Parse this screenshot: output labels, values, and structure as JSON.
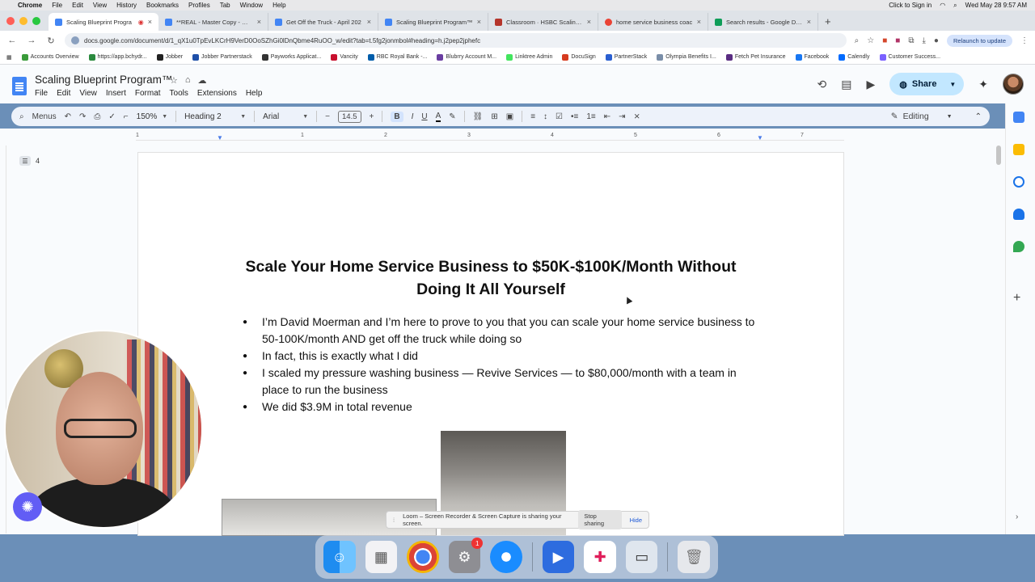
{
  "menubar": {
    "app": "Chrome",
    "items": [
      "File",
      "Edit",
      "View",
      "History",
      "Bookmarks",
      "Profiles",
      "Tab",
      "Window",
      "Help"
    ],
    "signin": "Click to Sign in",
    "datetime": "Wed May 28  9:57 AM"
  },
  "tabs": [
    {
      "label": "Scaling Blueprint Progra",
      "active": true
    },
    {
      "label": "**REAL - Master Copy - May",
      "active": false
    },
    {
      "label": "Get Off the Truck - April 202",
      "active": false
    },
    {
      "label": "Scaling Blueprint Program™",
      "active": false
    },
    {
      "label": "Classroom · HSBC Scaling B",
      "active": false
    },
    {
      "label": "home service business coac",
      "active": false
    },
    {
      "label": "Search results - Google Drive",
      "active": false
    }
  ],
  "address": {
    "url": "docs.google.com/document/d/1_qX1u0TpEvLKCrH9VerD0OoSZhGi0lDnQbme4RuOO_w/edit?tab=t.5fg2jonmbol#heading=h.j2pep2jphefc",
    "relaunch": "Relaunch to update"
  },
  "bookmarks": [
    "Accounts Overview",
    "https://app.bchydr...",
    "Jobber",
    "Jobber Partnerstack",
    "Payworks Applicat...",
    "Vancity",
    "RBC Royal Bank -...",
    "Blubrry Account M...",
    "Linktree Admin",
    "DocuSign",
    "PartnerStack",
    "Olympia Benefits I...",
    "Fetch Pet Insurance",
    "Facebook",
    "Calendly",
    "Customer Success..."
  ],
  "docs": {
    "title": "Scaling Blueprint Program™",
    "menu": [
      "File",
      "Edit",
      "View",
      "Insert",
      "Format",
      "Tools",
      "Extensions",
      "Help"
    ],
    "share_label": "Share",
    "toolbar": {
      "menus": "Menus",
      "zoom": "150%",
      "style": "Heading 2",
      "font": "Arial",
      "font_size": "14.5",
      "mode": "Editing"
    },
    "ruler_ticks": [
      "1",
      "1",
      "2",
      "3",
      "4",
      "5",
      "6",
      "7"
    ],
    "outline_count": "4"
  },
  "document": {
    "heading": "Scale Your Home Service Business to $50K-$100K/Month Without Doing It All Yourself",
    "bullets": [
      "I’m David Moerman and I’m here to prove to you that you can scale your home service business to 50-100K/month AND get off the truck while doing so",
      "In fact, this is exactly what I did",
      "I scaled my pressure washing business — Revive Services — to $80,000/month with a team in place to run the business",
      "We did $3.9M in total revenue"
    ]
  },
  "loom": {
    "message": "Loom – Screen Recorder & Screen Capture is sharing your screen.",
    "stop": "Stop sharing",
    "hide": "Hide"
  },
  "dock": {
    "settings_badge": "1"
  },
  "colors": {
    "share_bg": "#c2e7ff",
    "toolbar_bg": "#edf2fa",
    "docs_blue": "#4285f4",
    "loom_purple": "#625df5"
  }
}
